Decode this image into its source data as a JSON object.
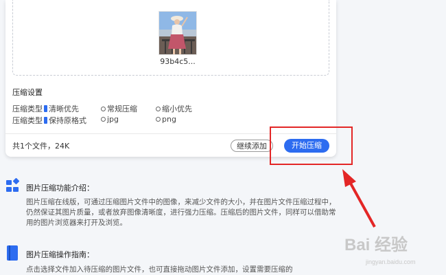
{
  "upload": {
    "file_name": "93b4c5..."
  },
  "settings": {
    "title": "压缩设置",
    "rows": [
      {
        "label": "压缩类型",
        "options": [
          {
            "label": "清晰优先",
            "selected": true
          },
          {
            "label": "常规压缩",
            "selected": false
          },
          {
            "label": "缩小优先",
            "selected": false
          }
        ]
      },
      {
        "label": "压缩类型",
        "options": [
          {
            "label": "保持原格式",
            "selected": true
          },
          {
            "label": "jpg",
            "selected": false
          },
          {
            "label": "png",
            "selected": false
          }
        ]
      }
    ]
  },
  "footer": {
    "summary": "共1个文件，24K",
    "continue_label": "继续添加",
    "start_label": "开始压缩"
  },
  "sections": [
    {
      "title": "图片压缩功能介绍：",
      "body": "图片压缩在线版，可通过压缩图片文件中的图像，来减少文件的大小，并在图片文件压缩过程中，仍然保证其图片质量，或者放弃图像清晰度，进行强力压缩。压缩后的图片文件，同样可以借助常用的图片浏览器来打开及浏览。"
    },
    {
      "title": "图片压缩操作指南：",
      "body": "点击选择文件加入待压缩的图片文件，也可直接拖动图片文件添加，设置需要压缩的"
    }
  ],
  "watermark": {
    "brand": "Bai 经验",
    "url": "jingyan.baidu.com"
  },
  "colors": {
    "accent": "#2d6cf0",
    "annotation": "#e32626"
  }
}
